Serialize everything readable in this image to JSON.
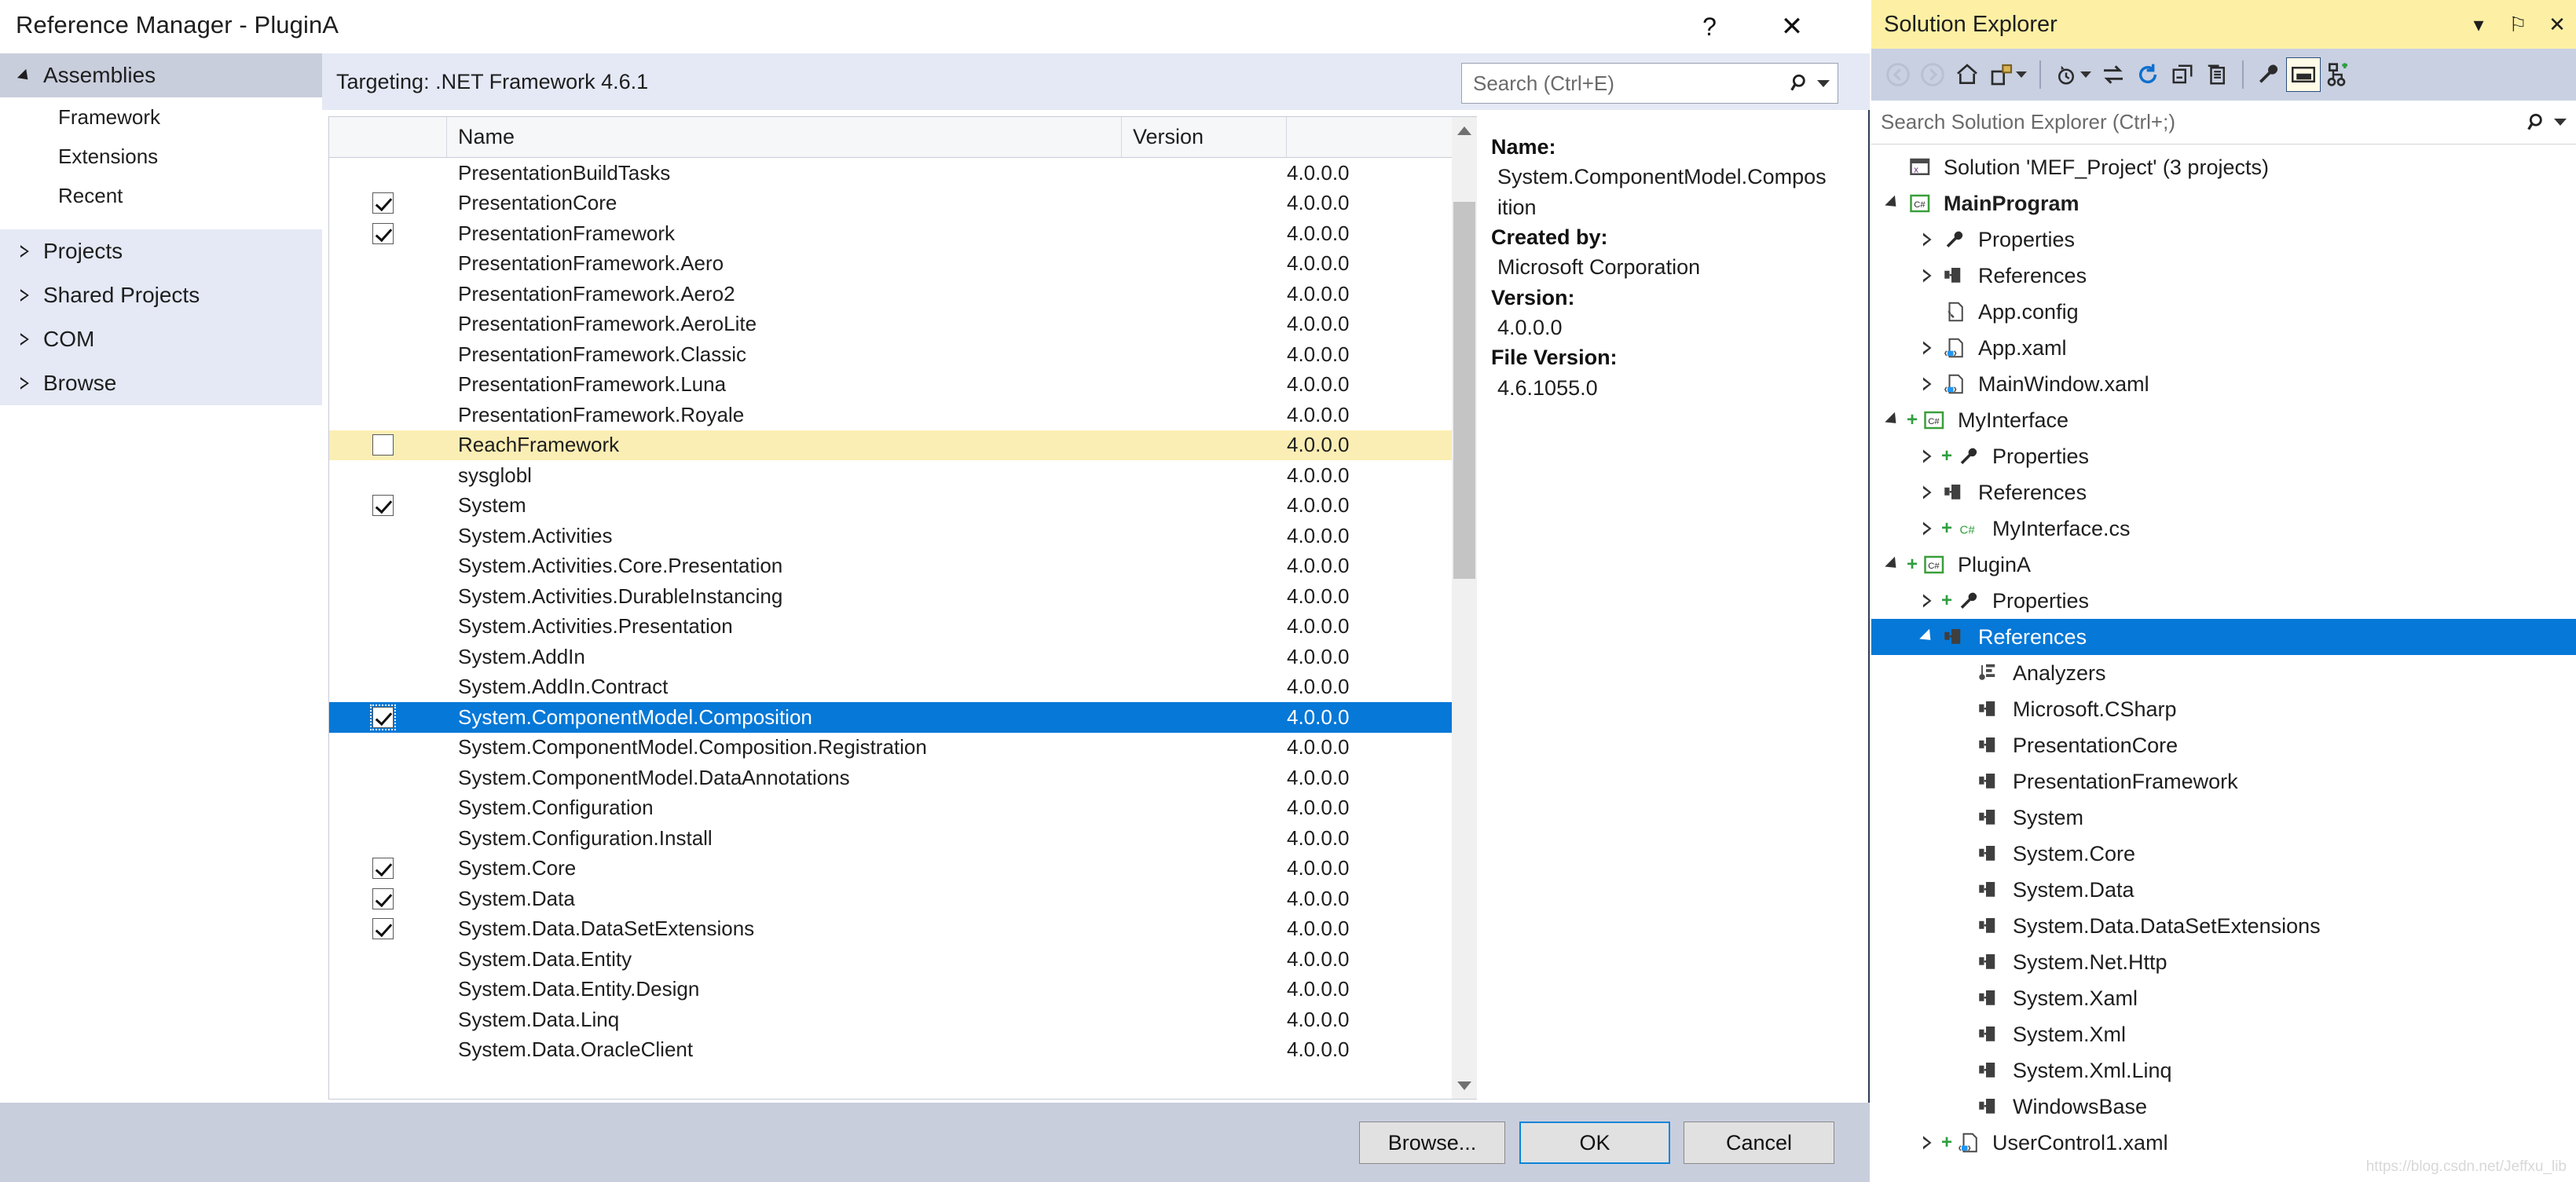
{
  "dialog": {
    "title": "Reference Manager - PluginA",
    "help_label": "?",
    "close_label": "✕",
    "targeting": "Targeting: .NET Framework 4.6.1",
    "search": {
      "placeholder": "Search (Ctrl+E)",
      "icon": "search-icon"
    },
    "nav": {
      "groups": [
        {
          "label": "Assemblies",
          "expanded": true,
          "children": [
            "Framework",
            "Extensions",
            "Recent"
          ]
        },
        {
          "label": "Projects",
          "expanded": false,
          "children": []
        },
        {
          "label": "Shared Projects",
          "expanded": false,
          "children": []
        },
        {
          "label": "COM",
          "expanded": false,
          "children": []
        },
        {
          "label": "Browse",
          "expanded": false,
          "children": []
        }
      ]
    },
    "list": {
      "columns": [
        "",
        "Name",
        "Version",
        ""
      ],
      "rows": [
        {
          "name": "PresentationBuildTasks",
          "version": "4.0.0.0",
          "checked": false,
          "state": "normal"
        },
        {
          "name": "PresentationCore",
          "version": "4.0.0.0",
          "checked": true,
          "state": "normal"
        },
        {
          "name": "PresentationFramework",
          "version": "4.0.0.0",
          "checked": true,
          "state": "normal"
        },
        {
          "name": "PresentationFramework.Aero",
          "version": "4.0.0.0",
          "checked": false,
          "state": "normal"
        },
        {
          "name": "PresentationFramework.Aero2",
          "version": "4.0.0.0",
          "checked": false,
          "state": "normal"
        },
        {
          "name": "PresentationFramework.AeroLite",
          "version": "4.0.0.0",
          "checked": false,
          "state": "normal"
        },
        {
          "name": "PresentationFramework.Classic",
          "version": "4.0.0.0",
          "checked": false,
          "state": "normal"
        },
        {
          "name": "PresentationFramework.Luna",
          "version": "4.0.0.0",
          "checked": false,
          "state": "normal"
        },
        {
          "name": "PresentationFramework.Royale",
          "version": "4.0.0.0",
          "checked": false,
          "state": "normal"
        },
        {
          "name": "ReachFramework",
          "version": "4.0.0.0",
          "checked": false,
          "state": "highlight"
        },
        {
          "name": "sysglobl",
          "version": "4.0.0.0",
          "checked": false,
          "state": "normal"
        },
        {
          "name": "System",
          "version": "4.0.0.0",
          "checked": true,
          "state": "normal"
        },
        {
          "name": "System.Activities",
          "version": "4.0.0.0",
          "checked": false,
          "state": "normal"
        },
        {
          "name": "System.Activities.Core.Presentation",
          "version": "4.0.0.0",
          "checked": false,
          "state": "normal"
        },
        {
          "name": "System.Activities.DurableInstancing",
          "version": "4.0.0.0",
          "checked": false,
          "state": "normal"
        },
        {
          "name": "System.Activities.Presentation",
          "version": "4.0.0.0",
          "checked": false,
          "state": "normal"
        },
        {
          "name": "System.AddIn",
          "version": "4.0.0.0",
          "checked": false,
          "state": "normal"
        },
        {
          "name": "System.AddIn.Contract",
          "version": "4.0.0.0",
          "checked": false,
          "state": "normal"
        },
        {
          "name": "System.ComponentModel.Composition",
          "version": "4.0.0.0",
          "checked": true,
          "state": "selected"
        },
        {
          "name": "System.ComponentModel.Composition.Registration",
          "version": "4.0.0.0",
          "checked": false,
          "state": "normal"
        },
        {
          "name": "System.ComponentModel.DataAnnotations",
          "version": "4.0.0.0",
          "checked": false,
          "state": "normal"
        },
        {
          "name": "System.Configuration",
          "version": "4.0.0.0",
          "checked": false,
          "state": "normal"
        },
        {
          "name": "System.Configuration.Install",
          "version": "4.0.0.0",
          "checked": false,
          "state": "normal"
        },
        {
          "name": "System.Core",
          "version": "4.0.0.0",
          "checked": true,
          "state": "normal"
        },
        {
          "name": "System.Data",
          "version": "4.0.0.0",
          "checked": true,
          "state": "normal"
        },
        {
          "name": "System.Data.DataSetExtensions",
          "version": "4.0.0.0",
          "checked": true,
          "state": "normal"
        },
        {
          "name": "System.Data.Entity",
          "version": "4.0.0.0",
          "checked": false,
          "state": "normal"
        },
        {
          "name": "System.Data.Entity.Design",
          "version": "4.0.0.0",
          "checked": false,
          "state": "normal"
        },
        {
          "name": "System.Data.Linq",
          "version": "4.0.0.0",
          "checked": false,
          "state": "normal"
        },
        {
          "name": "System.Data.OracleClient",
          "version": "4.0.0.0",
          "checked": false,
          "state": "normal"
        }
      ]
    },
    "detail": {
      "fields": [
        {
          "label": "Name:",
          "value": "System.ComponentModel.Composition"
        },
        {
          "label": "Created by:",
          "value": "Microsoft Corporation"
        },
        {
          "label": "Version:",
          "value": "4.0.0.0"
        },
        {
          "label": "File Version:",
          "value": "4.6.1055.0"
        }
      ]
    },
    "buttons": {
      "browse": "Browse...",
      "ok": "OK",
      "cancel": "Cancel"
    }
  },
  "solution_explorer": {
    "title": "Solution Explorer",
    "titlebar_buttons": [
      {
        "name": "window-menu-icon",
        "glyph": "▾"
      },
      {
        "name": "pin-icon",
        "glyph": "⚐"
      },
      {
        "name": "close-icon",
        "glyph": "✕"
      }
    ],
    "toolbar": [
      {
        "name": "back-icon"
      },
      {
        "name": "forward-icon"
      },
      {
        "name": "home-icon"
      },
      {
        "name": "sync-with-active-document-icon"
      },
      {
        "name": "dropdown-caret-icon"
      },
      {
        "name": "separator"
      },
      {
        "name": "pending-changes-filter-icon"
      },
      {
        "name": "dropdown-caret-icon"
      },
      {
        "name": "switch-views-icon"
      },
      {
        "name": "refresh-icon"
      },
      {
        "name": "collapse-all-icon"
      },
      {
        "name": "show-all-files-icon"
      },
      {
        "name": "separator"
      },
      {
        "name": "properties-wrench-icon"
      },
      {
        "name": "preview-selected-items-icon"
      },
      {
        "name": "solution-structure-icon"
      }
    ],
    "search": {
      "placeholder": "Search Solution Explorer (Ctrl+;)",
      "icon": "search-icon"
    },
    "tree": [
      {
        "label": "Solution 'MEF_Project' (3 projects)",
        "depth": 0,
        "twisty": "none",
        "icon": "solution-icon",
        "plus": false,
        "bold": false,
        "selected": false
      },
      {
        "label": "MainProgram",
        "depth": 0,
        "twisty": "down",
        "icon": "csharp-project-icon",
        "plus": false,
        "bold": true,
        "selected": false
      },
      {
        "label": "Properties",
        "depth": 1,
        "twisty": "right",
        "icon": "wrench-icon",
        "plus": false,
        "bold": false,
        "selected": false
      },
      {
        "label": "References",
        "depth": 1,
        "twisty": "right",
        "icon": "references-icon",
        "plus": false,
        "bold": false,
        "selected": false
      },
      {
        "label": "App.config",
        "depth": 1,
        "twisty": "none",
        "icon": "config-file-icon",
        "plus": false,
        "bold": false,
        "selected": false
      },
      {
        "label": "App.xaml",
        "depth": 1,
        "twisty": "right",
        "icon": "xaml-file-icon",
        "plus": false,
        "bold": false,
        "selected": false
      },
      {
        "label": "MainWindow.xaml",
        "depth": 1,
        "twisty": "right",
        "icon": "xaml-file-icon",
        "plus": false,
        "bold": false,
        "selected": false
      },
      {
        "label": "MyInterface",
        "depth": 0,
        "twisty": "down",
        "icon": "csharp-project-icon",
        "plus": true,
        "bold": false,
        "selected": false
      },
      {
        "label": "Properties",
        "depth": 1,
        "twisty": "right",
        "icon": "wrench-icon",
        "plus": true,
        "bold": false,
        "selected": false
      },
      {
        "label": "References",
        "depth": 1,
        "twisty": "right",
        "icon": "references-icon",
        "plus": false,
        "bold": false,
        "selected": false
      },
      {
        "label": "MyInterface.cs",
        "depth": 1,
        "twisty": "right",
        "icon": "csharp-file-icon",
        "plus": true,
        "bold": false,
        "selected": false
      },
      {
        "label": "PluginA",
        "depth": 0,
        "twisty": "down",
        "icon": "csharp-project-icon",
        "plus": true,
        "bold": false,
        "selected": false
      },
      {
        "label": "Properties",
        "depth": 1,
        "twisty": "right",
        "icon": "wrench-icon",
        "plus": true,
        "bold": false,
        "selected": false
      },
      {
        "label": "References",
        "depth": 1,
        "twisty": "down",
        "icon": "references-icon",
        "plus": false,
        "bold": false,
        "selected": true
      },
      {
        "label": "Analyzers",
        "depth": 2,
        "twisty": "none",
        "icon": "analyzers-icon",
        "plus": false,
        "bold": false,
        "selected": false
      },
      {
        "label": "Microsoft.CSharp",
        "depth": 2,
        "twisty": "none",
        "icon": "reference-icon",
        "plus": false,
        "bold": false,
        "selected": false
      },
      {
        "label": "PresentationCore",
        "depth": 2,
        "twisty": "none",
        "icon": "reference-icon",
        "plus": false,
        "bold": false,
        "selected": false
      },
      {
        "label": "PresentationFramework",
        "depth": 2,
        "twisty": "none",
        "icon": "reference-icon",
        "plus": false,
        "bold": false,
        "selected": false
      },
      {
        "label": "System",
        "depth": 2,
        "twisty": "none",
        "icon": "reference-icon",
        "plus": false,
        "bold": false,
        "selected": false
      },
      {
        "label": "System.Core",
        "depth": 2,
        "twisty": "none",
        "icon": "reference-icon",
        "plus": false,
        "bold": false,
        "selected": false
      },
      {
        "label": "System.Data",
        "depth": 2,
        "twisty": "none",
        "icon": "reference-icon",
        "plus": false,
        "bold": false,
        "selected": false
      },
      {
        "label": "System.Data.DataSetExtensions",
        "depth": 2,
        "twisty": "none",
        "icon": "reference-icon",
        "plus": false,
        "bold": false,
        "selected": false
      },
      {
        "label": "System.Net.Http",
        "depth": 2,
        "twisty": "none",
        "icon": "reference-icon",
        "plus": false,
        "bold": false,
        "selected": false
      },
      {
        "label": "System.Xaml",
        "depth": 2,
        "twisty": "none",
        "icon": "reference-icon",
        "plus": false,
        "bold": false,
        "selected": false
      },
      {
        "label": "System.Xml",
        "depth": 2,
        "twisty": "none",
        "icon": "reference-icon",
        "plus": false,
        "bold": false,
        "selected": false
      },
      {
        "label": "System.Xml.Linq",
        "depth": 2,
        "twisty": "none",
        "icon": "reference-icon",
        "plus": false,
        "bold": false,
        "selected": false
      },
      {
        "label": "WindowsBase",
        "depth": 2,
        "twisty": "none",
        "icon": "reference-icon",
        "plus": false,
        "bold": false,
        "selected": false
      },
      {
        "label": "UserControl1.xaml",
        "depth": 1,
        "twisty": "right",
        "icon": "xaml-file-icon",
        "plus": true,
        "bold": false,
        "selected": false
      }
    ],
    "watermark": "https://blog.csdn.net/Jeffxu_lib"
  },
  "colors": {
    "selection_blue": "#0678d7",
    "highlight_yellow": "#fbeeb4",
    "titlebar_yellow": "#fdf0a4",
    "toolbar_blue_gray": "#c9d0e2",
    "dialog_chrome": "#c9cedd",
    "panel_tint": "#e4e9f5"
  }
}
